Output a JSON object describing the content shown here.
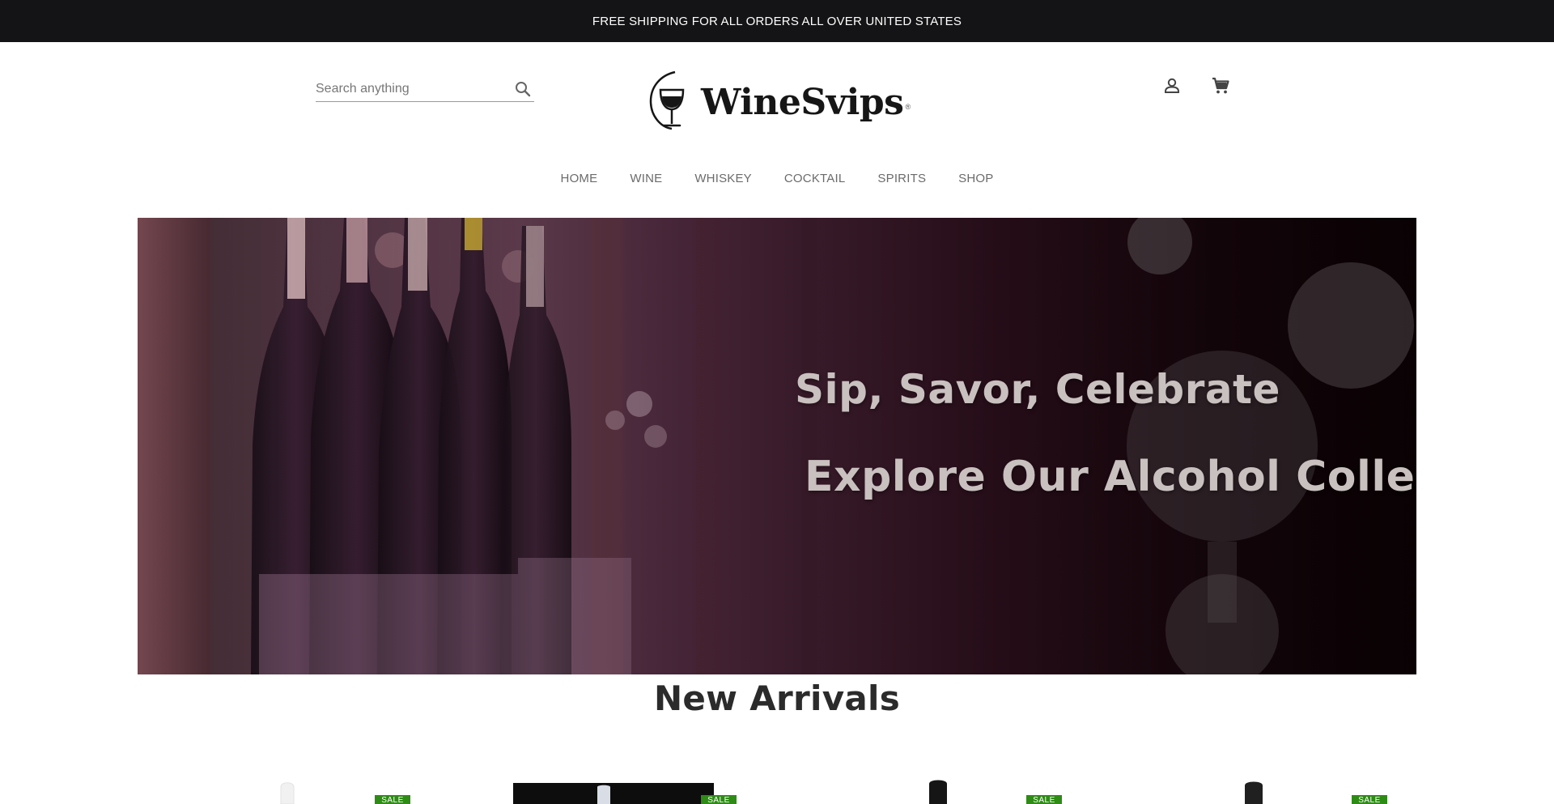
{
  "announcement": "FREE SHIPPING FOR ALL ORDERS ALL OVER UNITED STATES",
  "search": {
    "placeholder": "Search anything"
  },
  "brand": {
    "name": "WineSvips",
    "mark": "®"
  },
  "nav": [
    "HOME",
    "WINE",
    "WHISKEY",
    "COCKTAIL",
    "SPIRITS",
    "SHOP"
  ],
  "hero": {
    "line1": "Sip, Savor, Celebrate",
    "line2": "Explore Our Alcohol Collection!"
  },
  "section": {
    "title": "New Arrivals"
  },
  "products": [
    {
      "badge": "SALE"
    },
    {
      "badge": "SALE"
    },
    {
      "badge": "SALE"
    },
    {
      "badge": "SALE"
    }
  ],
  "colors": {
    "topbar": "#141416",
    "sale_badge": "#2e8b16",
    "nav_text": "#6b6b6b"
  },
  "icons": {
    "search": "search-icon",
    "account": "user-icon",
    "cart": "cart-icon"
  }
}
